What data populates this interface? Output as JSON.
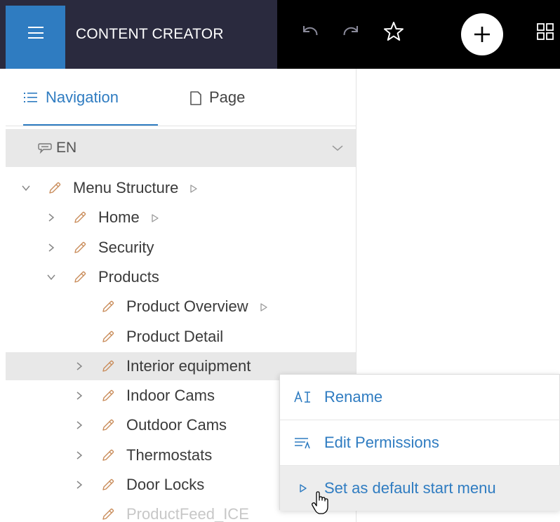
{
  "app": {
    "title": "CONTENT CREATOR"
  },
  "tabs": [
    {
      "label": "Navigation",
      "icon": "list-icon",
      "active": true
    },
    {
      "label": "Page",
      "icon": "page-icon",
      "active": false
    }
  ],
  "language": {
    "label": "EN",
    "icon": "speech-bubble-icon"
  },
  "tree": {
    "items": [
      {
        "label": "Menu Structure",
        "level": 0,
        "expander": "expanded",
        "start_marker": true,
        "highlighted": false,
        "faded": false
      },
      {
        "label": "Home",
        "level": 1,
        "expander": "collapsed",
        "start_marker": true,
        "highlighted": false,
        "faded": false
      },
      {
        "label": "Security",
        "level": 1,
        "expander": "collapsed",
        "start_marker": false,
        "highlighted": false,
        "faded": false
      },
      {
        "label": "Products",
        "level": 1,
        "expander": "expanded",
        "start_marker": false,
        "highlighted": false,
        "faded": false
      },
      {
        "label": "Product Overview",
        "level": 2,
        "expander": "none",
        "start_marker": true,
        "highlighted": false,
        "faded": false
      },
      {
        "label": "Product Detail",
        "level": 2,
        "expander": "none",
        "start_marker": false,
        "highlighted": false,
        "faded": false
      },
      {
        "label": "Interior equipment",
        "level": 2,
        "expander": "collapsed",
        "start_marker": false,
        "highlighted": true,
        "faded": false
      },
      {
        "label": "Indoor Cams",
        "level": 2,
        "expander": "collapsed",
        "start_marker": false,
        "highlighted": false,
        "faded": false
      },
      {
        "label": "Outdoor Cams",
        "level": 2,
        "expander": "collapsed",
        "start_marker": false,
        "highlighted": false,
        "faded": false
      },
      {
        "label": "Thermostats",
        "level": 2,
        "expander": "collapsed",
        "start_marker": false,
        "highlighted": false,
        "faded": false
      },
      {
        "label": "Door Locks",
        "level": 2,
        "expander": "collapsed",
        "start_marker": false,
        "highlighted": false,
        "faded": false
      },
      {
        "label": "ProductFeed_ICE",
        "level": 2,
        "expander": "none",
        "start_marker": false,
        "highlighted": false,
        "faded": true
      }
    ]
  },
  "context_menu": {
    "items": [
      {
        "label": "Rename",
        "icon": "rename-icon",
        "hovered": false
      },
      {
        "label": "Edit Permissions",
        "icon": "permissions-icon",
        "hovered": false
      },
      {
        "label": "Set as default start menu",
        "icon": "play-outline-icon",
        "hovered": true
      }
    ]
  },
  "colors": {
    "accent": "#2f7cc1",
    "topbar_left": "#2a2a3e",
    "topbar_right": "#000000",
    "highlight_row": "#e8e8e8",
    "pencil": "#c98c5a"
  }
}
